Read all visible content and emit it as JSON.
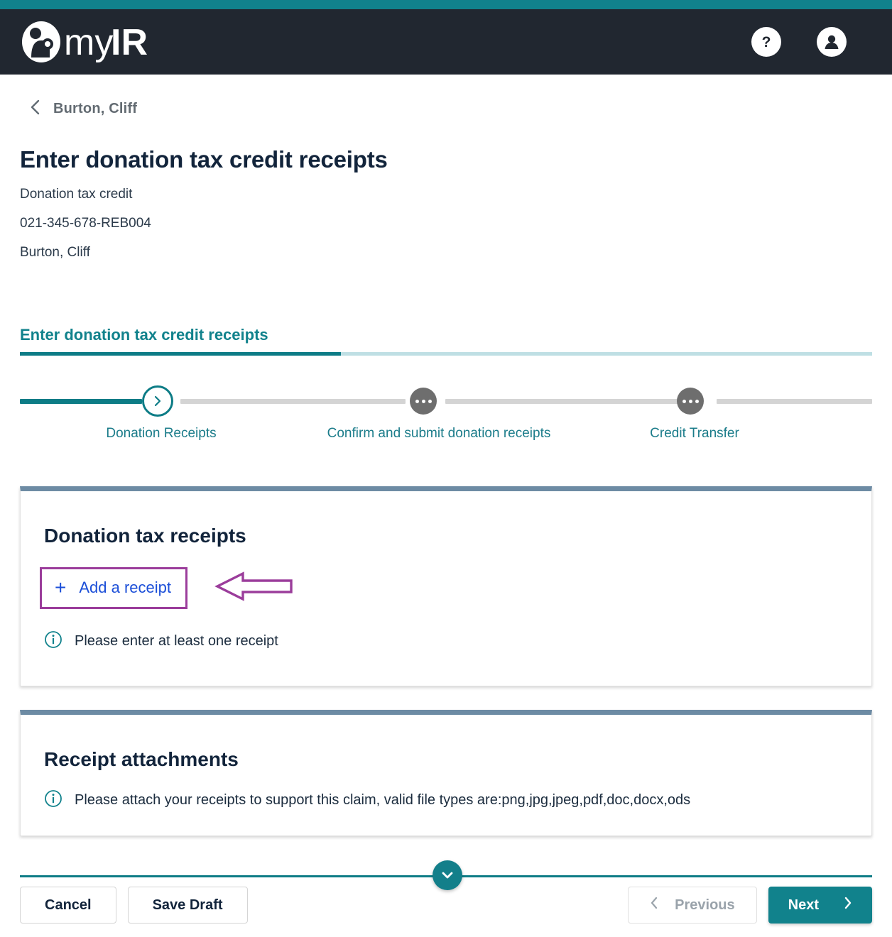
{
  "app": {
    "brand": "myIR",
    "help_icon": "question-mark-circle-icon",
    "account_icon": "user-account-icon"
  },
  "breadcrumb": {
    "back_icon": "chevron-left-icon",
    "label": "Burton, Cliff"
  },
  "header": {
    "title": "Enter donation tax credit receipts",
    "subtitle": "Donation tax credit",
    "reference": "021-345-678-REB004",
    "customer": "Burton, Cliff"
  },
  "section_tab": {
    "label": "Enter donation tax credit receipts"
  },
  "stepper": {
    "steps": [
      {
        "label": "Donation Receipts",
        "state": "active"
      },
      {
        "label": "Confirm and submit donation receipts",
        "state": "pending"
      },
      {
        "label": "Credit Transfer",
        "state": "pending"
      }
    ]
  },
  "receipts_card": {
    "title": "Donation tax receipts",
    "add_receipt_label": "Add a receipt",
    "add_receipt_icon": "plus-icon",
    "info_icon": "info-circle-icon",
    "info_text": "Please enter at least one receipt"
  },
  "attachments_card": {
    "title": "Receipt attachments",
    "info_icon": "info-circle-icon",
    "info_text": "Please attach your receipts to support this claim, valid file types are:png,jpg,jpeg,pdf,doc,docx,ods"
  },
  "scroll_button": {
    "icon": "chevron-down-icon"
  },
  "footer": {
    "cancel_label": "Cancel",
    "save_draft_label": "Save Draft",
    "previous_label": "Previous",
    "previous_icon": "chevron-left-icon",
    "next_label": "Next",
    "next_icon": "chevron-right-icon"
  },
  "annotations": {
    "highlight_color": "#9b3d9b",
    "arrow_icon": "arrow-left-annotation"
  },
  "colors": {
    "teal": "#11828c",
    "header_bar": "#212730",
    "card_top_border": "#6d8ba4",
    "link_blue": "#1c4fd8",
    "title_navy": "#12243b"
  }
}
